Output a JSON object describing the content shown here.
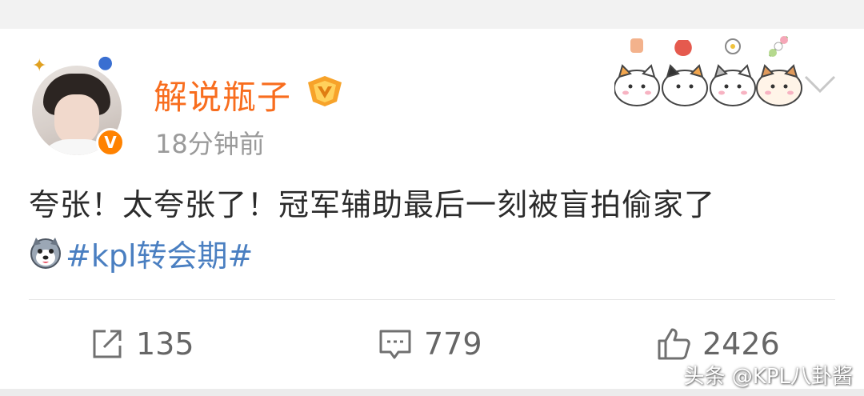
{
  "post": {
    "author": "解说瓶子",
    "time": "18分钟前",
    "verified_badge": "V",
    "text": "夸张！太夸张了！冠军辅助最后一刻被盲拍偷家了",
    "topic": "#kpl转会期#"
  },
  "actions": {
    "repost_count": "135",
    "comment_count": "779",
    "like_count": "2426"
  },
  "watermark": "头条 @KPL八卦酱",
  "icons": {
    "avatar_decoration": "cartoon-avatar-decoration",
    "level": "gold-level-badge-icon",
    "stickers": [
      "cat-sticker-icon",
      "cat-sticker-icon",
      "cat-sticker-icon",
      "cat-sticker-icon"
    ],
    "expand": "chevron-down-icon",
    "emoji": "husky-emoji-icon",
    "repost": "repost-icon",
    "comment": "comment-icon",
    "like": "thumbs-up-icon"
  },
  "colors": {
    "username": "#f86d1e",
    "topic": "#4a7fc1",
    "verified": "#ff8200",
    "meta": "#9a9a9a",
    "text": "#2b2b2b"
  }
}
